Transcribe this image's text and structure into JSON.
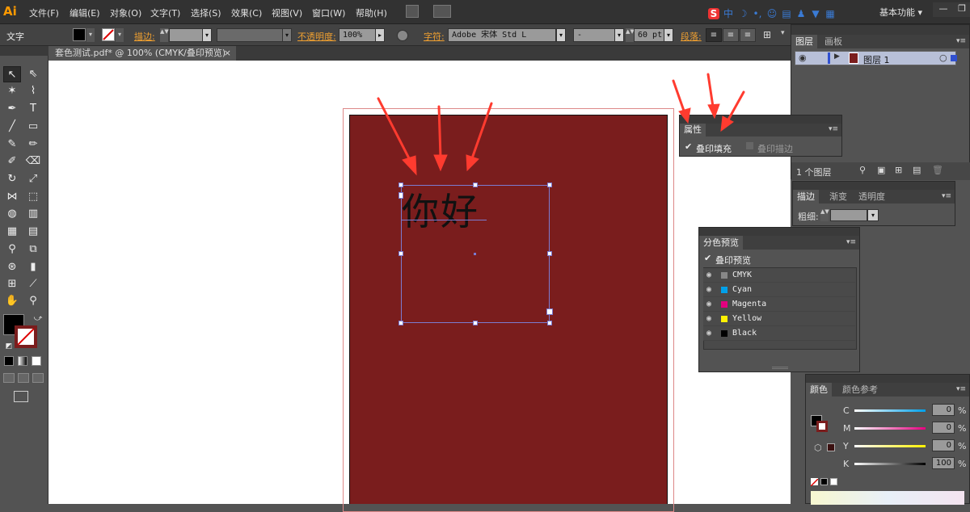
{
  "app": {
    "logo": "Ai",
    "workspace": "基本功能 ▾"
  },
  "menu": [
    "文件(F)",
    "编辑(E)",
    "对象(O)",
    "文字(T)",
    "选择(S)",
    "效果(C)",
    "视图(V)",
    "窗口(W)",
    "帮助(H)"
  ],
  "ime": {
    "logo": "S",
    "mode": "中"
  },
  "window_controls": {
    "minimize": "—",
    "restore": "❐"
  },
  "control_bar": {
    "type_label": "文字",
    "stroke_label": "描边:",
    "opacity_label": "不透明度:",
    "opacity_value": "100%",
    "char_label": "字符:",
    "font_value": "Adobe 宋体 Std L",
    "style_value": "-",
    "size_value": "60 pt",
    "para_label": "段落:"
  },
  "document": {
    "tab_title": "套色测试.pdf* @ 100% (CMYK/叠印预览)",
    "close": "×",
    "sample_text": "你好"
  },
  "layers_panel": {
    "tabs": [
      "图层",
      "画板"
    ],
    "layer_name": "图层 1",
    "count": "1 个图层"
  },
  "attributes_panel": {
    "title": "属性",
    "overprint_fill": "叠印填充",
    "overprint_stroke": "叠印描边"
  },
  "stroke_panel": {
    "tabs": [
      "描边",
      "渐变",
      "透明度"
    ],
    "weight_label": "粗细:"
  },
  "separations_panel": {
    "title": "分色预览",
    "overprint_preview": "叠印预览",
    "plates": [
      {
        "name": "CMYK",
        "color": "#888888"
      },
      {
        "name": "Cyan",
        "color": "#00a0e9"
      },
      {
        "name": "Magenta",
        "color": "#e4007f"
      },
      {
        "name": "Yellow",
        "color": "#fff100"
      },
      {
        "name": "Black",
        "color": "#000000"
      }
    ]
  },
  "color_panel": {
    "tabs": [
      "颜色",
      "颜色参考"
    ],
    "channels": [
      {
        "label": "C",
        "value": "0",
        "unit": "%"
      },
      {
        "label": "M",
        "value": "0",
        "unit": "%"
      },
      {
        "label": "Y",
        "value": "0",
        "unit": "%"
      },
      {
        "label": "K",
        "value": "100",
        "unit": "%"
      }
    ]
  },
  "colors": {
    "fill": "#7a1d1d",
    "accent": "#f0a030",
    "selection": "#7b7bd0",
    "arrow": "#ff3b2f"
  }
}
